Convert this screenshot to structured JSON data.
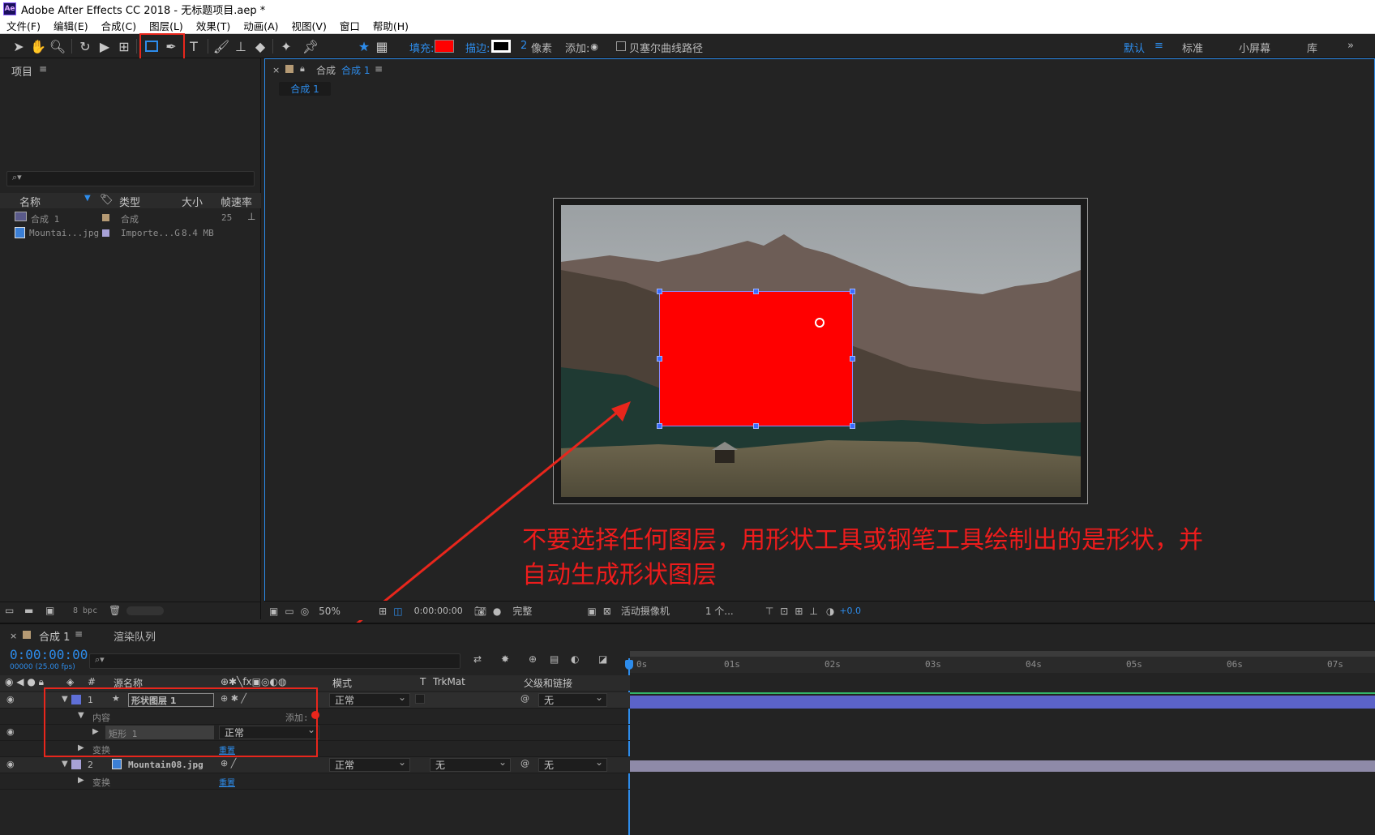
{
  "window": {
    "logo": "Ae",
    "title": "Adobe After Effects CC 2018 - 无标题项目.aep *"
  },
  "menu": [
    "文件(F)",
    "编辑(E)",
    "合成(C)",
    "图层(L)",
    "效果(T)",
    "动画(A)",
    "视图(V)",
    "窗口",
    "帮助(H)"
  ],
  "toolbar": {
    "fill_label": "填充:",
    "stroke_label": "描边:",
    "stroke_width": "2",
    "stroke_unit": "像素",
    "add_label": "添加:",
    "bezier_label": "贝塞尔曲线路径",
    "fill_color": "#ff0000",
    "workspaces": [
      "默认",
      "标准",
      "小屏幕",
      "库"
    ],
    "overflow": "»"
  },
  "project": {
    "title": "项目",
    "search_placeholder": "⌕▾",
    "columns": [
      "名称",
      "类型",
      "大小",
      "帧速率"
    ],
    "items": [
      {
        "name": "合成 1",
        "type": "合成",
        "size": "",
        "fps": "25",
        "label_color": "#b59a74"
      },
      {
        "name": "Mountai...jpg",
        "type": "Importe...G",
        "size": "8.4 MB",
        "fps": "",
        "label_color": "#a7a1d6"
      }
    ],
    "bpc": "8 bpc"
  },
  "viewer": {
    "close": "×",
    "tab_prefix": "合成",
    "tab_name": "合成 1",
    "comp_tab": "合成 1",
    "annotation_line1": "不要选择任何图层，用形状工具或钢笔工具绘制出的是形状，并",
    "annotation_line2": "自动生成形状图层",
    "zoom": "50%",
    "timecode": "0:00:00:00",
    "resolution": "完整",
    "camera": "活动摄像机",
    "views": "1 个...",
    "exposure": "+0.0"
  },
  "timeline": {
    "tab": "合成 1",
    "render_queue": "渲染队列",
    "timecode": "0:00:00:00",
    "frame_info": "00000 (25.00 fps)",
    "search_placeholder": "⌕▾",
    "columns": {
      "source": "源名称",
      "mode": "模式",
      "t": "T",
      "trkmat": "TrkMat",
      "parent": "父级和链接"
    },
    "ruler": [
      "0s",
      "01s",
      "02s",
      "03s",
      "04s",
      "05s",
      "06s",
      "07s"
    ],
    "layers": [
      {
        "num": "1",
        "name": "形状图层 1",
        "mode": "正常",
        "parent": "无",
        "label_color": "#5f6fd6"
      },
      {
        "num": "2",
        "name": "Mountain08.jpg",
        "mode": "正常",
        "trkmat": "无",
        "parent": "无",
        "label_color": "#a7a1d6"
      }
    ],
    "contents_label": "内容",
    "add_label": "添加:",
    "rect_label": "矩形 1",
    "rect_mode": "正常",
    "transform_label": "变换",
    "reset_label": "重置"
  }
}
